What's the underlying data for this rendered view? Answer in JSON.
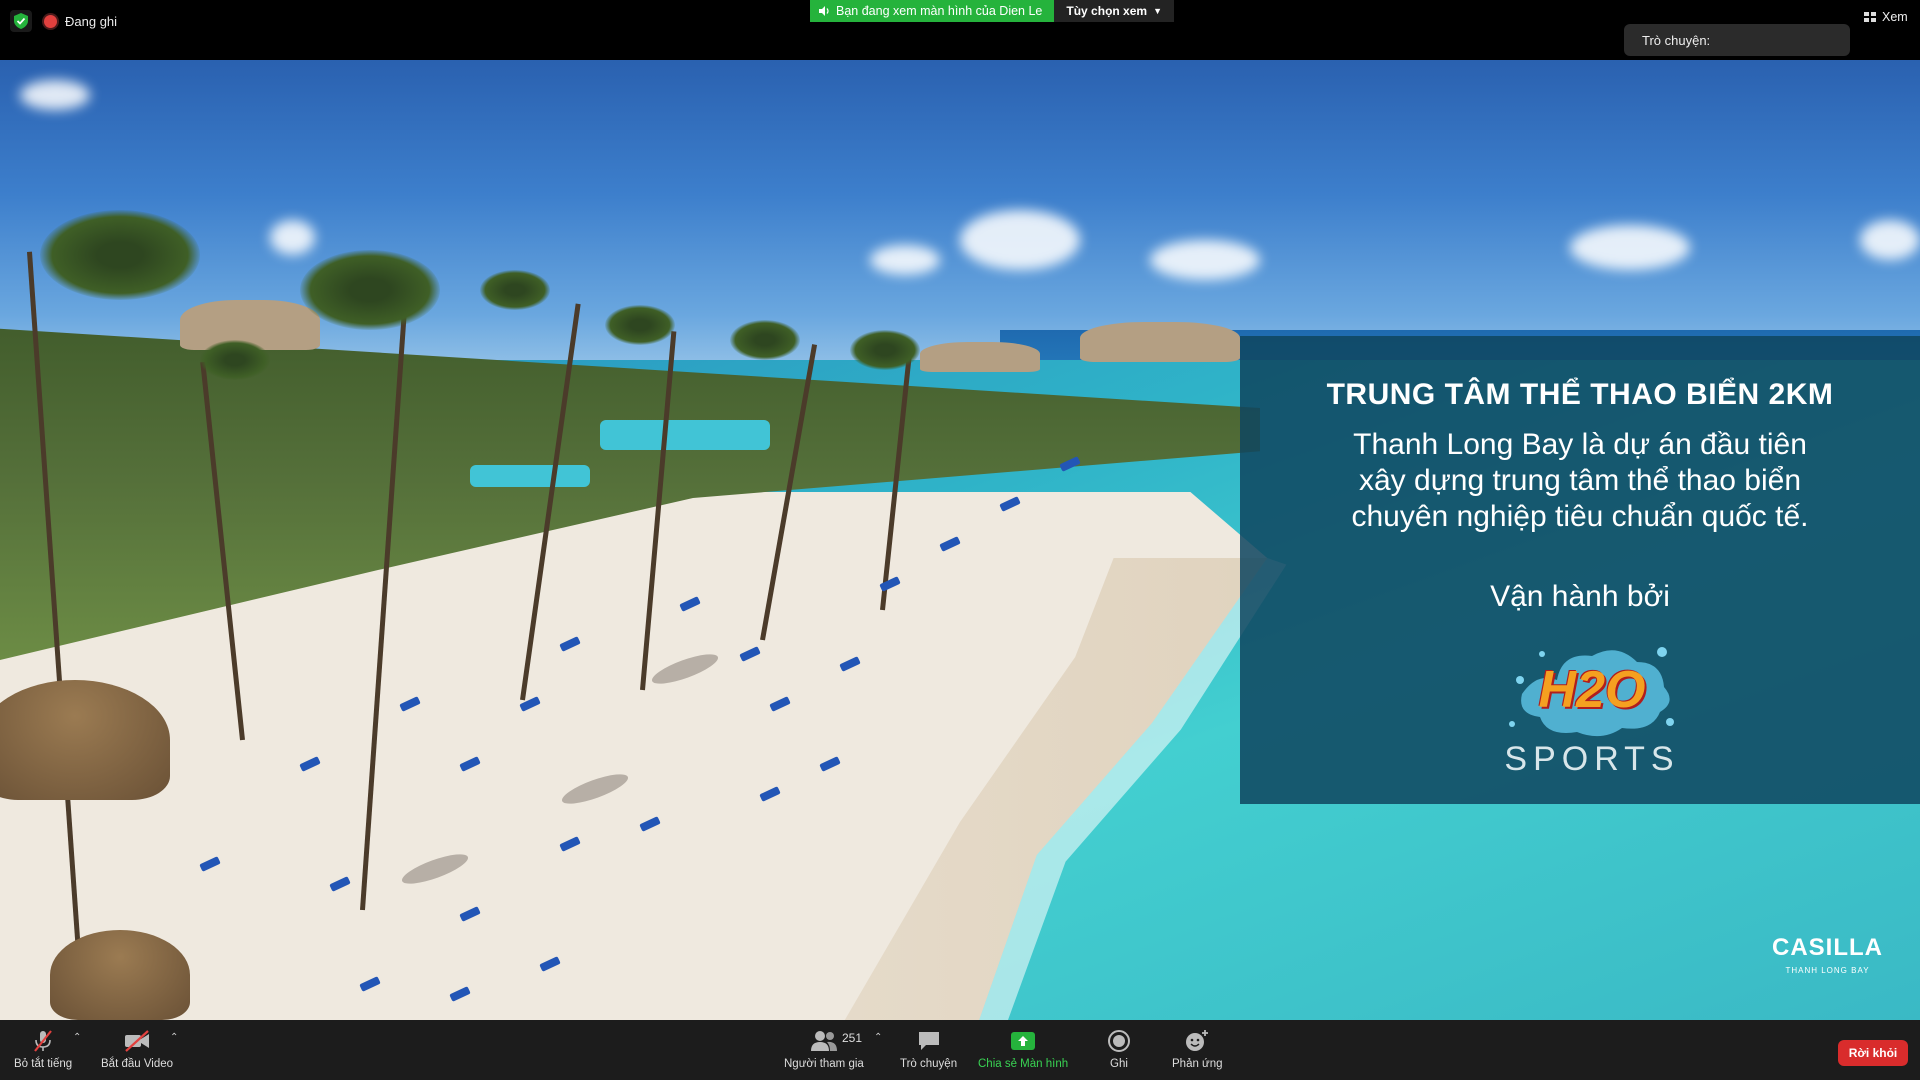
{
  "topbar": {
    "recording_label": "Đang ghi",
    "share_banner": "Bạn đang xem màn hình của Dien Le",
    "view_options": "Tùy chọn xem",
    "chat_pill": "Trò chuyện:",
    "view_button": "Xem"
  },
  "slide": {
    "title": "TRUNG TÂM THỂ THAO BIỂN 2KM",
    "body_lines": [
      "Thanh Long Bay là dự án đầu tiên",
      "xây dựng trung tâm thể thao biển",
      "chuyên nghiệp tiêu chuẩn quốc tế."
    ],
    "operated_by": "Vận hành bởi",
    "logo_text": "H2O",
    "logo_sub": "SPORTS",
    "brand": "CASILLA",
    "brand_sub": "THANH LONG BAY"
  },
  "toolbar": {
    "mute": "Bỏ tắt tiếng",
    "video": "Bắt đầu Video",
    "participants": "Người tham gia",
    "participants_count": "251",
    "chat": "Trò chuyện",
    "share": "Chia sẻ Màn hình",
    "record": "Ghi",
    "reactions": "Phản ứng",
    "leave": "Rời khỏi"
  },
  "colors": {
    "share_green": "#25b33c",
    "leave_red": "#d92c2c",
    "overlay": "#0f465f"
  }
}
